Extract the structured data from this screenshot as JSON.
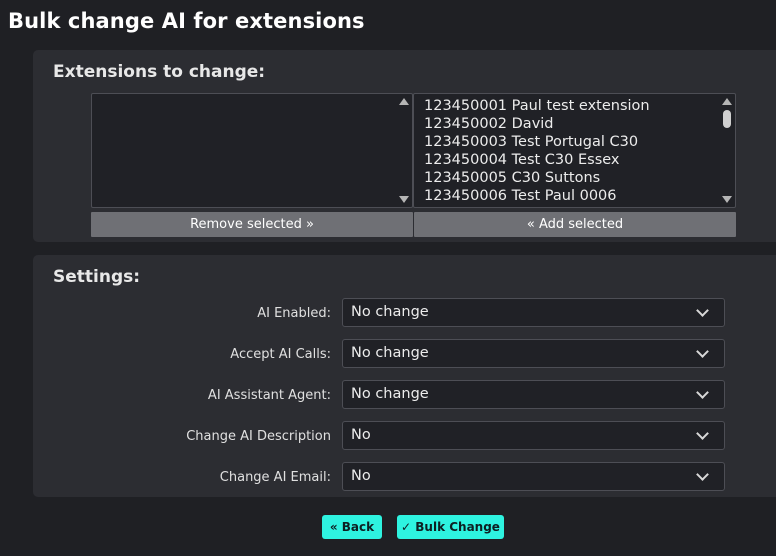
{
  "page": {
    "title": "Bulk change AI for extensions"
  },
  "extensions": {
    "heading": "Extensions to change:",
    "selected_items": [],
    "available_items": [
      "123450001 Paul test extension",
      "123450002 David",
      "123450003 Test Portugal C30",
      "123450004 Test C30 Essex",
      "123450005 C30 Suttons",
      "123450006 Test Paul 0006"
    ],
    "remove_label": "Remove selected »",
    "add_label": "« Add selected"
  },
  "settings": {
    "heading": "Settings:",
    "fields": [
      {
        "label": "AI Enabled:",
        "value": "No change"
      },
      {
        "label": "Accept AI Calls:",
        "value": "No change"
      },
      {
        "label": "AI Assistant Agent:",
        "value": "No change"
      },
      {
        "label": "Change AI Description",
        "value": "No"
      },
      {
        "label": "Change AI Email:",
        "value": "No"
      }
    ]
  },
  "actions": {
    "back_label": "« Back",
    "bulk_change_label": "✓ Bulk Change"
  },
  "colors": {
    "accent": "#2ef3e0",
    "panel": "#2c2d32",
    "background": "#1f2024"
  }
}
